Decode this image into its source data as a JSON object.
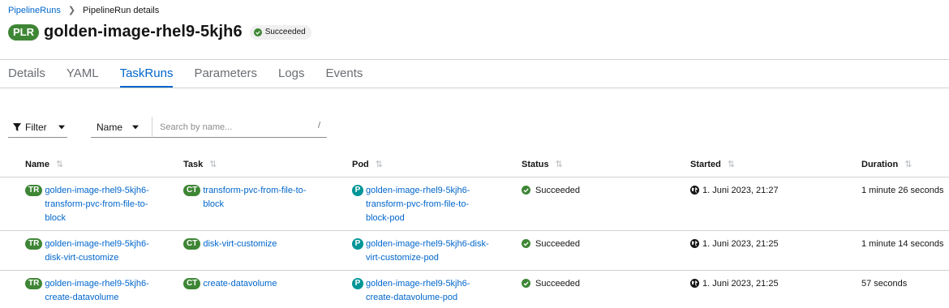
{
  "breadcrumb": {
    "parent": "PipelineRuns",
    "current": "PipelineRun details"
  },
  "header": {
    "badge": "PLR",
    "title": "golden-image-rhel9-5kjh6",
    "status": "Succeeded"
  },
  "tabs": [
    {
      "label": "Details"
    },
    {
      "label": "YAML"
    },
    {
      "label": "TaskRuns"
    },
    {
      "label": "Parameters"
    },
    {
      "label": "Logs"
    },
    {
      "label": "Events"
    }
  ],
  "active_tab": "TaskRuns",
  "toolbar": {
    "filter_label": "Filter",
    "name_label": "Name",
    "search_placeholder": "Search by name...",
    "shortcut": "/"
  },
  "table": {
    "columns": [
      "Name",
      "Task",
      "Pod",
      "Status",
      "Started",
      "Duration"
    ],
    "rows": [
      {
        "name_badge": "TR",
        "name": [
          "golden-image-rhel9-5kjh6-",
          "transform-pvc-from-file-to-",
          "block"
        ],
        "task_badge": "CT",
        "task": [
          "transform-pvc-from-file-to-",
          "block"
        ],
        "pod_badge": "P",
        "pod": [
          "golden-image-rhel9-5kjh6-",
          "transform-pvc-from-file-to-",
          "block-pod"
        ],
        "status": "Succeeded",
        "started": "1. Juni 2023, 21:27",
        "duration": "1 minute 26 seconds"
      },
      {
        "name_badge": "TR",
        "name": [
          "golden-image-rhel9-5kjh6-",
          "disk-virt-customize"
        ],
        "task_badge": "CT",
        "task": [
          "disk-virt-customize"
        ],
        "pod_badge": "P",
        "pod": [
          "golden-image-rhel9-5kjh6-disk-",
          "virt-customize-pod"
        ],
        "status": "Succeeded",
        "started": "1. Juni 2023, 21:25",
        "duration": "1 minute 14 seconds"
      },
      {
        "name_badge": "TR",
        "name": [
          "golden-image-rhel9-5kjh6-",
          "create-datavolume"
        ],
        "task_badge": "CT",
        "task": [
          "create-datavolume"
        ],
        "pod_badge": "P",
        "pod": [
          "golden-image-rhel9-5kjh6-",
          "create-datavolume-pod"
        ],
        "status": "Succeeded",
        "started": "1. Juni 2023, 21:25",
        "duration": "57 seconds"
      }
    ]
  },
  "colors": {
    "link": "#0066cc",
    "success": "#3e8635",
    "pod": "#009596"
  },
  "icons": {
    "status": "check-circle-icon",
    "started": "globe-icon",
    "filter": "funnel-icon",
    "sort": "sort-icon"
  }
}
